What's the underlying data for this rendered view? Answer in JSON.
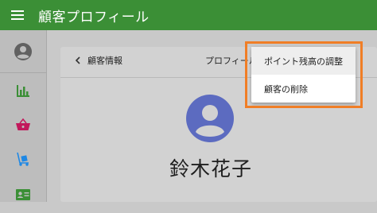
{
  "appbar": {
    "title": "顧客プロフィール",
    "menu_icon": "hamburger-icon"
  },
  "sidebar": {
    "items": [
      {
        "icon": "account-circle-icon"
      },
      {
        "icon": "bar-chart-icon",
        "color": "#3b8f36"
      },
      {
        "icon": "shopping-basket-icon",
        "color": "#c2185b"
      },
      {
        "icon": "luggage-cart-icon",
        "color": "#1e88e5"
      },
      {
        "icon": "contact-card-icon",
        "color": "#3b8f36"
      }
    ]
  },
  "card": {
    "back_label": "顧客情報",
    "title": "プロフィール",
    "avatar_color": "#5c6bc0",
    "customer_name": "鈴木花子"
  },
  "dropdown": {
    "items": [
      {
        "label": "ポイント残高の調整"
      },
      {
        "label": "顧客の削除"
      }
    ]
  },
  "highlight_color": "#f07e26"
}
